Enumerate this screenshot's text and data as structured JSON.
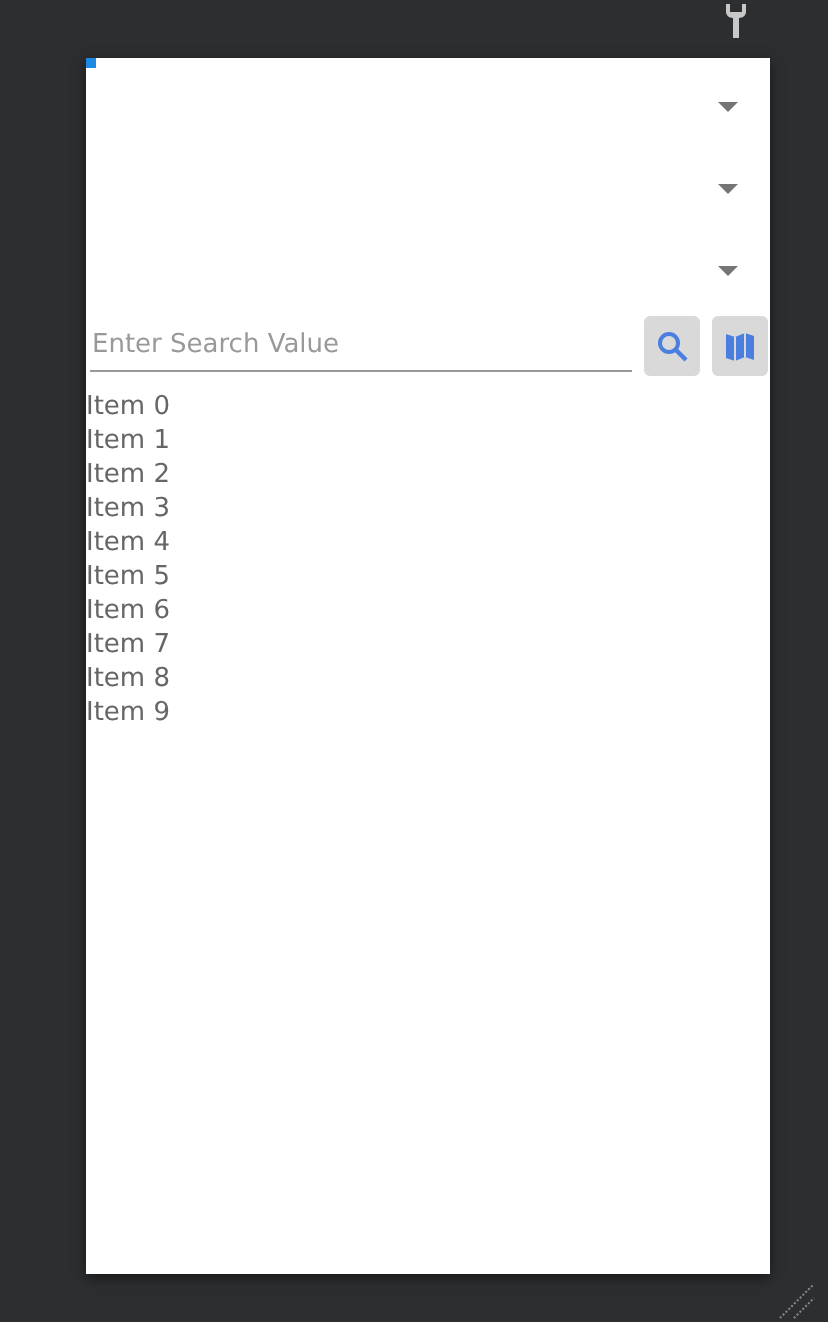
{
  "dropdowns": [
    {
      "kind": "select"
    },
    {
      "kind": "select"
    },
    {
      "kind": "select"
    }
  ],
  "search": {
    "placeholder": "Enter Search Value"
  },
  "items": [
    "Item 0",
    "Item 1",
    "Item 2",
    "Item 3",
    "Item 4",
    "Item 5",
    "Item 6",
    "Item 7",
    "Item 8",
    "Item 9"
  ]
}
